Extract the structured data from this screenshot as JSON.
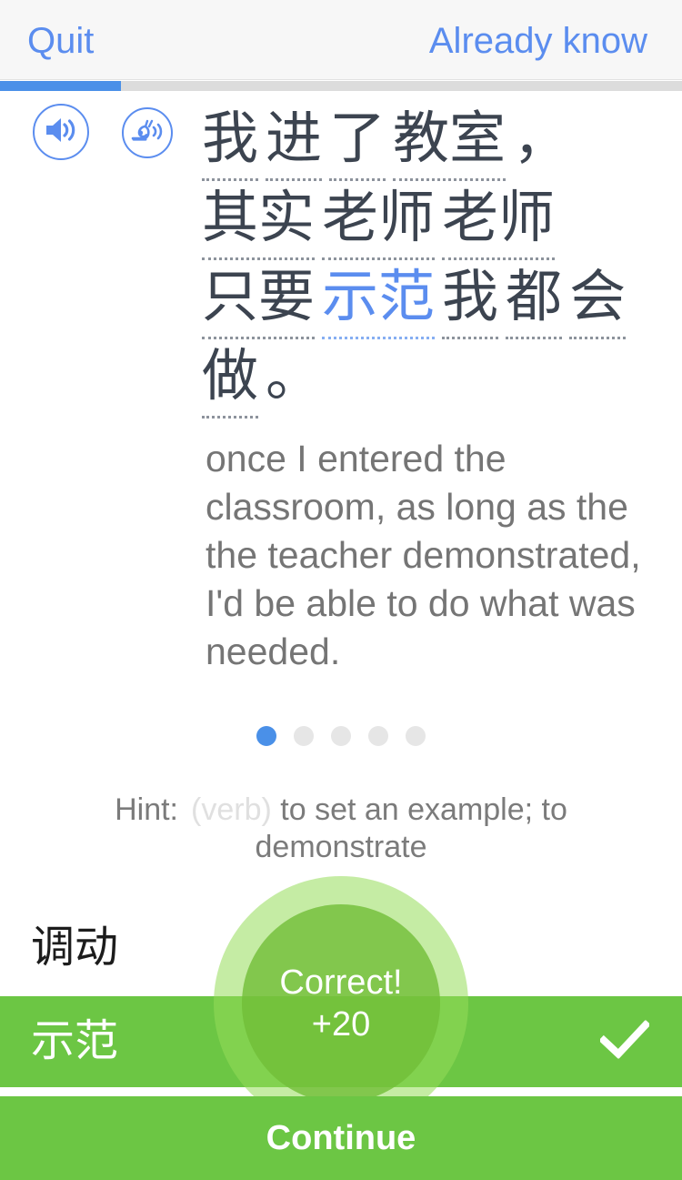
{
  "topbar": {
    "quit_label": "Quit",
    "already_know_label": "Already know"
  },
  "progress": {
    "percent": 17.8
  },
  "audio": {
    "normal_icon": "speaker-icon",
    "slow_icon": "snail-speaker-icon"
  },
  "sentence": {
    "segments": [
      {
        "text": "我",
        "highlight": false,
        "underline": true
      },
      {
        "text": "进",
        "highlight": false,
        "underline": true
      },
      {
        "text": "了",
        "highlight": false,
        "underline": true
      },
      {
        "text": "教室",
        "highlight": false,
        "underline": true
      },
      {
        "text": "，",
        "highlight": false,
        "underline": false
      },
      {
        "text": "其实",
        "highlight": false,
        "underline": true
      },
      {
        "text": "老师",
        "highlight": false,
        "underline": true
      },
      {
        "text": "老师",
        "highlight": false,
        "underline": true
      },
      {
        "text": "只要",
        "highlight": false,
        "underline": true
      },
      {
        "text": "示范",
        "highlight": true,
        "underline": true
      },
      {
        "text": "我",
        "highlight": false,
        "underline": true
      },
      {
        "text": "都",
        "highlight": false,
        "underline": true
      },
      {
        "text": "会",
        "highlight": false,
        "underline": true
      },
      {
        "text": "做",
        "highlight": false,
        "underline": true
      },
      {
        "text": "。",
        "highlight": false,
        "underline": false
      }
    ]
  },
  "translation": {
    "text": "once I entered the classroom, as long as the the teacher demonstrated, I'd be able to do what was needed."
  },
  "dots": {
    "total": 5,
    "active_index": 0
  },
  "hint": {
    "label": "Hint:",
    "part_of_speech": "(verb)",
    "definition": "to set an example; to demonstrate"
  },
  "options": [
    {
      "text": "调动",
      "state": "neutral",
      "check": false
    },
    {
      "text": "示范",
      "state": "correct",
      "check": true
    }
  ],
  "feedback": {
    "label": "Correct!",
    "points": "+20"
  },
  "continue": {
    "label": "Continue"
  },
  "colors": {
    "accent_blue": "#5b8def",
    "progress_blue": "#4a90e8",
    "correct_green": "#6cc644",
    "text_dark": "#3c4450",
    "text_gray": "#757575",
    "hint_pos_gray": "#e0e0e0"
  }
}
